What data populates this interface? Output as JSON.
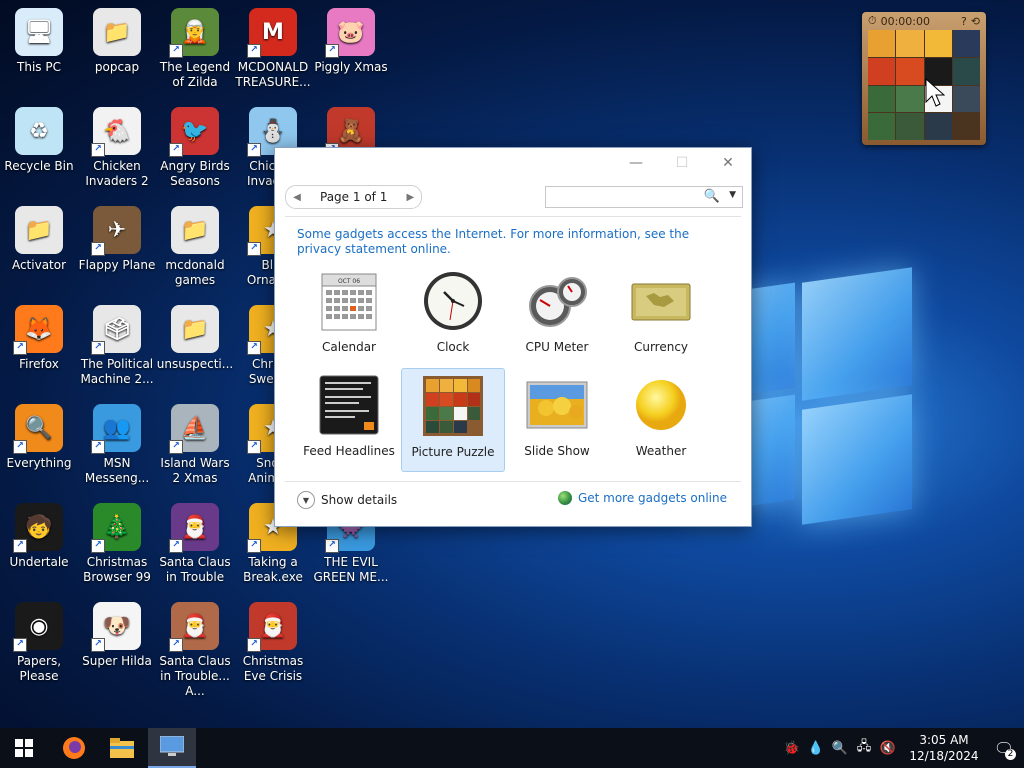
{
  "desktop": {
    "icons": [
      {
        "label": "This PC",
        "shortcut": false,
        "color": "#d9ecfa",
        "glyph": "🖥"
      },
      {
        "label": "popcap",
        "shortcut": false,
        "color": "#e8e8e8",
        "glyph": "📁"
      },
      {
        "label": "The Legend of Zilda",
        "shortcut": true,
        "color": "#5a8a3a",
        "glyph": "🧝"
      },
      {
        "label": "MCDONALD TREASURE...",
        "shortcut": true,
        "color": "#d42a1e",
        "glyph": "M"
      },
      {
        "label": "Piggly Xmas",
        "shortcut": true,
        "color": "#e87ac4",
        "glyph": "🐷"
      },
      {
        "label": "Recycle Bin",
        "shortcut": false,
        "color": "#bfe4f6",
        "glyph": "♻"
      },
      {
        "label": "Chicken Invaders 2",
        "shortcut": true,
        "color": "#f2f2f2",
        "glyph": "🐔"
      },
      {
        "label": "Angry Birds Seasons",
        "shortcut": true,
        "color": "#c33",
        "glyph": "🐦"
      },
      {
        "label": "Chicken Invade...",
        "shortcut": true,
        "color": "#8fc7ef",
        "glyph": "⛄"
      },
      {
        "label": "",
        "shortcut": true,
        "color": "#c0392b",
        "glyph": "🧸"
      },
      {
        "label": "Activator",
        "shortcut": false,
        "color": "#e8e8e8",
        "glyph": "📁"
      },
      {
        "label": "Flappy Plane",
        "shortcut": true,
        "color": "#7a5a3a",
        "glyph": "✈"
      },
      {
        "label": "mcdonald games",
        "shortcut": false,
        "color": "#e8e8e8",
        "glyph": "📁"
      },
      {
        "label": "Bl... Ornam...",
        "shortcut": true,
        "color": "#f0b020",
        "glyph": "★"
      },
      {
        "label": "Firefox",
        "shortcut": true,
        "color": "#ff7a1a",
        "glyph": "🦊"
      },
      {
        "label": "The Political Machine 2...",
        "shortcut": true,
        "color": "#e7e7e7",
        "glyph": "🗳"
      },
      {
        "label": "unsuspecti...",
        "shortcut": false,
        "color": "#e8e8e8",
        "glyph": "📁"
      },
      {
        "label": "Chris... Sweet...",
        "shortcut": true,
        "color": "#f0b020",
        "glyph": "★"
      },
      {
        "label": "Everything",
        "shortcut": true,
        "color": "#f08a1a",
        "glyph": "🔍"
      },
      {
        "label": "MSN Messeng...",
        "shortcut": true,
        "color": "#3a9ae0",
        "glyph": "👥"
      },
      {
        "label": "Island Wars 2 Xmas",
        "shortcut": true,
        "color": "#aab4bc",
        "glyph": "⛵"
      },
      {
        "label": "Sno... Anima...",
        "shortcut": true,
        "color": "#f0b020",
        "glyph": "★"
      },
      {
        "label": "Undertale",
        "shortcut": true,
        "color": "#1a1a1a",
        "glyph": "🧒"
      },
      {
        "label": "Christmas Browser 99",
        "shortcut": true,
        "color": "#2a8a2a",
        "glyph": "🎄"
      },
      {
        "label": "Santa Claus in Trouble",
        "shortcut": true,
        "color": "#6a3a8a",
        "glyph": "🎅"
      },
      {
        "label": "Taking a Break.exe",
        "shortcut": true,
        "color": "#f0b020",
        "glyph": "★"
      },
      {
        "label": "THE EVIL GREEN ME...",
        "shortcut": true,
        "color": "#3a9ae0",
        "glyph": "👾"
      },
      {
        "label": "Papers, Please",
        "shortcut": true,
        "color": "#1a1a1a",
        "glyph": "◉"
      },
      {
        "label": "Super Hilda",
        "shortcut": true,
        "color": "#f5f5f5",
        "glyph": "🐶"
      },
      {
        "label": "Santa Claus in Trouble... A...",
        "shortcut": true,
        "color": "#b06a4a",
        "glyph": "🎅"
      },
      {
        "label": "Christmas Eve Crisis",
        "shortcut": true,
        "color": "#c0392b",
        "glyph": "🎅"
      }
    ]
  },
  "puzzle_gadget": {
    "timer": "00:00:00",
    "help": "?"
  },
  "dialog": {
    "pager": {
      "text": "Page 1 of 1",
      "prev": "◀",
      "next": "▶"
    },
    "search": {
      "placeholder": "",
      "icon": "🔍",
      "dropdown": "▼"
    },
    "notice": "Some gadgets access the Internet.  For more information, see the privacy statement online.",
    "gadgets": [
      {
        "name": "Calendar"
      },
      {
        "name": "Clock"
      },
      {
        "name": "CPU Meter"
      },
      {
        "name": "Currency"
      },
      {
        "name": "Feed Headlines"
      },
      {
        "name": "Picture Puzzle",
        "selected": true
      },
      {
        "name": "Slide Show"
      },
      {
        "name": "Weather"
      }
    ],
    "calendar_month": "OCT 06",
    "show_details": "Show details",
    "more_online": "Get more gadgets online",
    "titlebar": {
      "minimize": "—",
      "maximize": "☐",
      "close": "✕"
    }
  },
  "taskbar": {
    "time": "3:05 AM",
    "date": "12/18/2024",
    "notifications_count": "2"
  },
  "colors": {
    "accent": "#1a6fc4",
    "taskbar": "#0b0f17"
  }
}
